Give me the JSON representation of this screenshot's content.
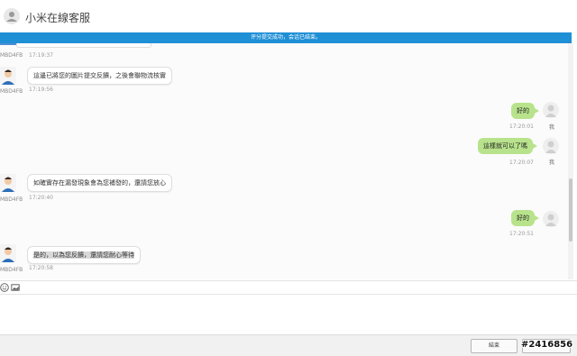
{
  "header": {
    "title": "小米在線客服"
  },
  "banner": {
    "text": "评分提交成功，会话已结束。"
  },
  "messages": [
    {
      "side": "left",
      "id": "MBD4FB",
      "time": "17:19:37",
      "partial": true
    },
    {
      "side": "left",
      "id": "MBD4FB",
      "text": "這邊已將您的圖片提交反饋，之後會聯物流核實",
      "time": "17:19:56"
    },
    {
      "side": "right",
      "text": "好的",
      "time": "17:20:01",
      "user": "我"
    },
    {
      "side": "right",
      "text": "這樣就可以了嗎",
      "time": "17:20:07",
      "user": "我"
    },
    {
      "side": "left",
      "id": "MBD4FB",
      "text": "如確實存在漏發現象會為您補發的，還請您放心",
      "time": "17:20:40"
    },
    {
      "side": "right",
      "text": "好的",
      "time": "17:20:51",
      "user": "我"
    },
    {
      "side": "left",
      "id": "MBD4FB",
      "text": "是的，以為您反饋，還請您耐心等待",
      "time": "17:20:58"
    }
  ],
  "toolbar": {
    "icons": [
      "emoji-icon",
      "image-icon"
    ]
  },
  "footer": {
    "end_label": "結束"
  },
  "watermark": {
    "text": "#2416856"
  }
}
